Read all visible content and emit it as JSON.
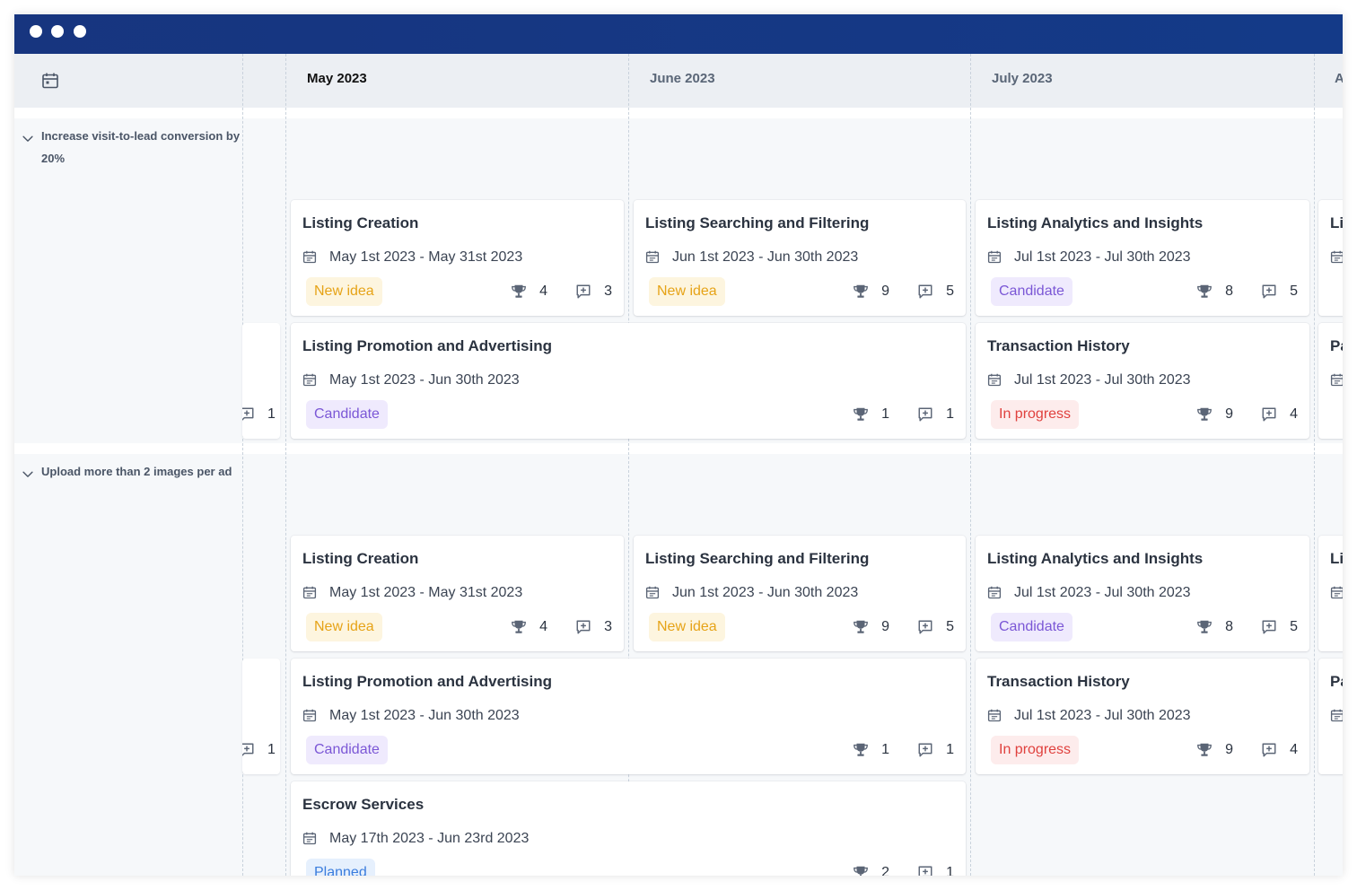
{
  "header": {
    "months": [
      "May 2023",
      "June 2023",
      "July 2023",
      "A"
    ]
  },
  "groups": [
    {
      "label": "Increase visit-to-lead conversion by 20%",
      "stub_count": "1",
      "cards": [
        {
          "title": "Listing Creation",
          "date": "May 1st 2023 - May 31st 2023",
          "status": "New idea",
          "votes": "4",
          "comments": "3"
        },
        {
          "title": "Listing Searching and Filtering",
          "date": "Jun 1st 2023 - Jun 30th 2023",
          "status": "New idea",
          "votes": "9",
          "comments": "5"
        },
        {
          "title": "Listing Analytics and Insights",
          "date": "Jul 1st 2023 - Jul 30th 2023",
          "status": "Candidate",
          "votes": "8",
          "comments": "5"
        },
        {
          "title": "Listing Promotion and Advertising",
          "date": "May 1st 2023 - Jun 30th 2023",
          "status": "Candidate",
          "votes": "1",
          "comments": "1"
        },
        {
          "title": "Transaction History",
          "date": "Jul 1st 2023 - Jul 30th 2023",
          "status": "In progress",
          "votes": "9",
          "comments": "4"
        }
      ],
      "cut_cards": [
        "Li",
        "Pa"
      ]
    },
    {
      "label": "Upload more than 2 images per ad",
      "stub_count": "1",
      "cards": [
        {
          "title": "Listing Creation",
          "date": "May 1st 2023 - May 31st 2023",
          "status": "New idea",
          "votes": "4",
          "comments": "3"
        },
        {
          "title": "Listing Searching and Filtering",
          "date": "Jun 1st 2023 - Jun 30th 2023",
          "status": "New idea",
          "votes": "9",
          "comments": "5"
        },
        {
          "title": "Listing Analytics and Insights",
          "date": "Jul 1st 2023 - Jul 30th 2023",
          "status": "Candidate",
          "votes": "8",
          "comments": "5"
        },
        {
          "title": "Listing Promotion and Advertising",
          "date": "May 1st 2023 - Jun 30th 2023",
          "status": "Candidate",
          "votes": "1",
          "comments": "1"
        },
        {
          "title": "Transaction History",
          "date": "Jul 1st 2023 - Jul 30th 2023",
          "status": "In progress",
          "votes": "9",
          "comments": "4"
        },
        {
          "title": "Escrow Services",
          "date": "May 17th 2023 - Jun 23rd 2023",
          "status": "Planned",
          "votes": "2",
          "comments": "1"
        }
      ],
      "cut_cards": [
        "Li",
        "Pa"
      ]
    }
  ],
  "icons": {
    "calendar": "calendar-icon",
    "chevron": "chevron-down-icon",
    "trophy": "trophy-icon",
    "comment": "comment-icon",
    "window_controls": "window-dot"
  },
  "colors": {
    "titlebar": "#17357f",
    "new_idea": "#e6a317",
    "candidate": "#7b57d6",
    "in_progress": "#e0413e",
    "planned": "#3b7ddd"
  }
}
